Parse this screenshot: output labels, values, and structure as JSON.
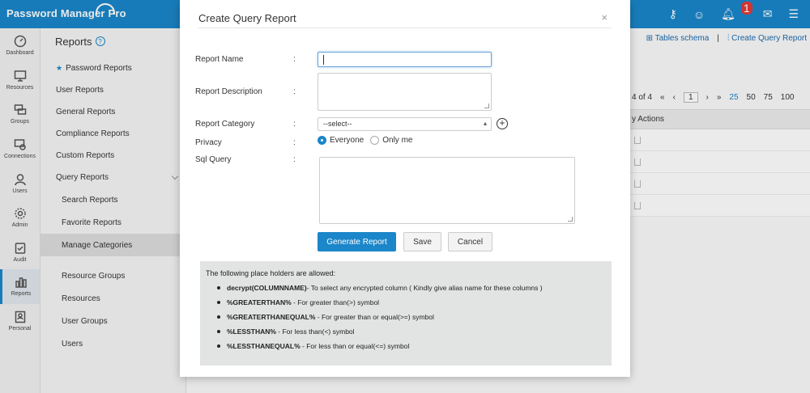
{
  "app": {
    "title": "Password Manager Pro"
  },
  "leftnav": [
    {
      "label": "Dashboard",
      "icon": "dashboard-icon"
    },
    {
      "label": "Resources",
      "icon": "monitor-icon"
    },
    {
      "label": "Groups",
      "icon": "groups-icon"
    },
    {
      "label": "Connections",
      "icon": "connections-icon"
    },
    {
      "label": "Users",
      "icon": "user-icon"
    },
    {
      "label": "Admin",
      "icon": "gear-icon"
    },
    {
      "label": "Audit",
      "icon": "audit-icon"
    },
    {
      "label": "Reports",
      "icon": "reports-icon"
    },
    {
      "label": "Personal",
      "icon": "personal-icon"
    }
  ],
  "submenu": {
    "title": "Reports",
    "items": [
      {
        "label": "Password Reports"
      },
      {
        "label": "User Reports"
      },
      {
        "label": "General Reports"
      },
      {
        "label": "Compliance Reports"
      },
      {
        "label": "Custom Reports"
      },
      {
        "label": "Query Reports"
      },
      {
        "label": "Search Reports"
      },
      {
        "label": "Favorite Reports"
      },
      {
        "label": "Manage Categories"
      },
      {
        "label": "Resource Groups"
      },
      {
        "label": "Resources"
      },
      {
        "label": "User Groups"
      },
      {
        "label": "Users"
      }
    ]
  },
  "main": {
    "links": {
      "tables_schema": "Tables schema",
      "create_query": "Create Query Report"
    },
    "pager": {
      "range": "4 of 4",
      "page": "1",
      "sizes": [
        "25",
        "50",
        "75",
        "100"
      ]
    },
    "table": {
      "actions_header": "y Actions"
    }
  },
  "modal": {
    "title": "Create Query Report",
    "close": "×",
    "fields": {
      "report_name": "Report Name",
      "report_description": "Report Description",
      "report_category": "Report Category",
      "privacy": "Privacy",
      "sql_query": "Sql Query",
      "colon": ":"
    },
    "category_value": "--select--",
    "privacy_options": {
      "everyone": "Everyone",
      "only_me": "Only me"
    },
    "buttons": {
      "generate": "Generate Report",
      "save": "Save",
      "cancel": "Cancel"
    },
    "info": {
      "intro": "The following place holders are allowed:",
      "items": [
        {
          "key": "decrypt(COLUMNNAME)",
          "desc": "- To select any encrypted column ( Kindly give alias name for these columns )"
        },
        {
          "key": "%GREATERTHAN%",
          "desc": " - For greater than(>) symbol"
        },
        {
          "key": "%GREATERTHANEQUAL%",
          "desc": " - For greater than or equal(>=) symbol"
        },
        {
          "key": "%LESSTHAN%",
          "desc": " - For less than(<) symbol"
        },
        {
          "key": "%LESSTHANEQUAL%",
          "desc": " - For less than or equal(<=) symbol"
        }
      ]
    }
  },
  "notifications": {
    "count": "1"
  }
}
